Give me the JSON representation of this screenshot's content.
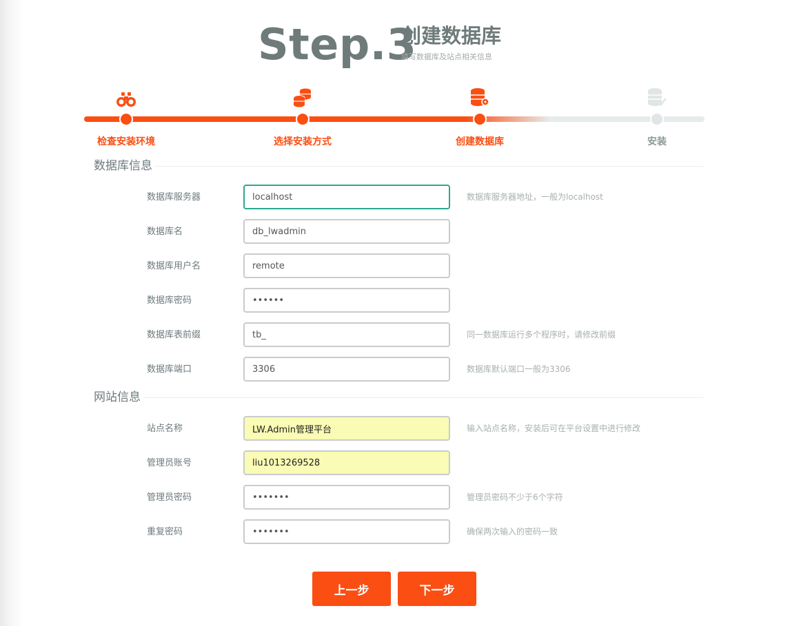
{
  "header": {
    "step": "Step.3",
    "title": "创建数据库",
    "subtitle": "填写数据库及站点相关信息"
  },
  "progress": {
    "completed_fraction": 0.75,
    "accent_color": "#fb4e12",
    "steps": [
      {
        "label": "检查安装环境",
        "icon": "binoculars-icon",
        "state": "done"
      },
      {
        "label": "选择安装方式",
        "icon": "coins-icon",
        "state": "done"
      },
      {
        "label": "创建数据库",
        "icon": "database-key-icon",
        "state": "current"
      },
      {
        "label": "安装",
        "icon": "database-check-icon",
        "state": "pending"
      }
    ]
  },
  "db_section": {
    "title": "数据库信息",
    "fields": [
      {
        "label": "数据库服务器",
        "value": "localhost",
        "hint": "数据库服务器地址，一般为localhost"
      },
      {
        "label": "数据库名",
        "value": "db_lwadmin",
        "hint": ""
      },
      {
        "label": "数据库用户名",
        "value": "remote",
        "hint": ""
      },
      {
        "label": "数据库密码",
        "value": "••••••",
        "hint": ""
      },
      {
        "label": "数据库表前缀",
        "value": "tb_",
        "hint": "同一数据库运行多个程序时，请修改前缀"
      },
      {
        "label": "数据库端口",
        "value": "3306",
        "hint": "数据库默认端口一般为3306"
      }
    ]
  },
  "site_section": {
    "title": "网站信息",
    "fields": [
      {
        "label": "站点名称",
        "value": "LW.Admin管理平台",
        "hint": "输入站点名称，安装后可在平台设置中进行修改"
      },
      {
        "label": "管理员账号",
        "value": "liu1013269528",
        "hint": ""
      },
      {
        "label": "管理员密码",
        "value": "•••••••",
        "hint": "管理员密码不少于6个字符"
      },
      {
        "label": "重复密码",
        "value": "•••••••",
        "hint": "确保两次输入的密码一致"
      }
    ]
  },
  "buttons": {
    "prev": "上一步",
    "next": "下一步"
  }
}
